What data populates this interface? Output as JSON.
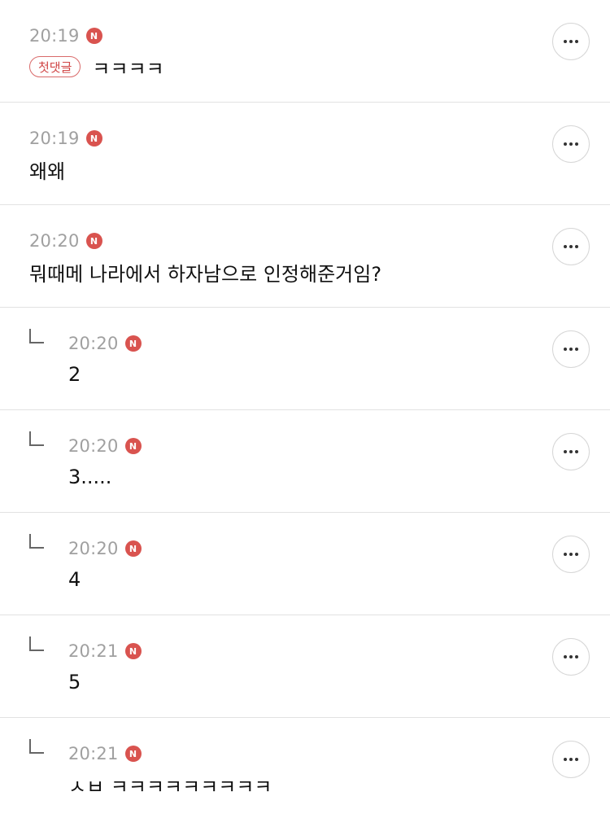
{
  "badge_glyph": "N",
  "first_comment_tag": "첫댓글",
  "comments": [
    {
      "time": "20:19",
      "text": "ㅋㅋㅋㅋ",
      "is_reply": false,
      "first": true
    },
    {
      "time": "20:19",
      "text": "왜왜",
      "is_reply": false,
      "first": false
    },
    {
      "time": "20:20",
      "text": "뭐때메 나라에서 하자남으로 인정해준거임?",
      "is_reply": false,
      "first": false
    },
    {
      "time": "20:20",
      "text": "2",
      "is_reply": true,
      "first": false
    },
    {
      "time": "20:20",
      "text": "3.....",
      "is_reply": true,
      "first": false
    },
    {
      "time": "20:20",
      "text": "4",
      "is_reply": true,
      "first": false
    },
    {
      "time": "20:21",
      "text": "5",
      "is_reply": true,
      "first": false
    },
    {
      "time": "20:21",
      "text": "ㅅㅂ ㅋㅋㅋㅋㅋㅋㅋㅋㅋ",
      "is_reply": true,
      "first": false
    }
  ],
  "colors": {
    "badge": "#d9534f",
    "tag_border": "#d96a6a",
    "time": "#a0a0a0",
    "divider": "#e2e2e2"
  },
  "icons": {
    "new_badge": "new-badge-icon",
    "more": "more-options-icon",
    "reply": "reply-arrow-icon"
  }
}
